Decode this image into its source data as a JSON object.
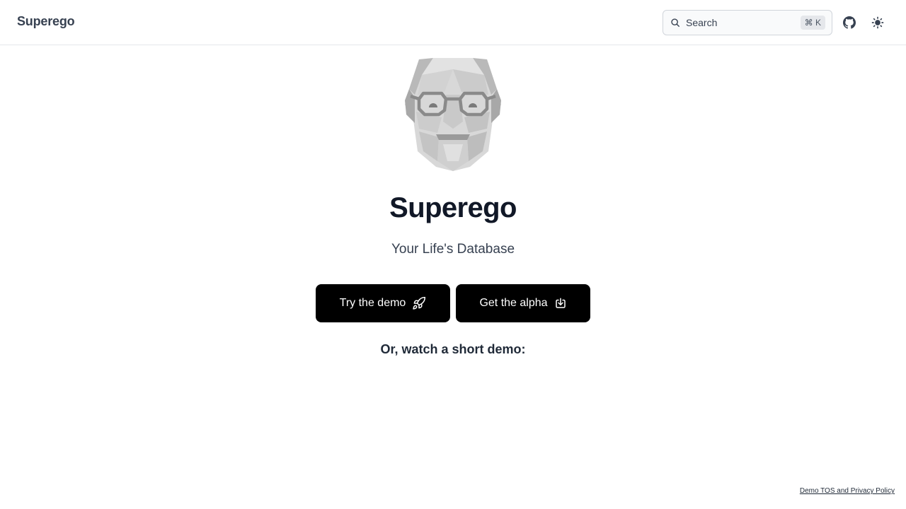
{
  "header": {
    "brand": "Superego",
    "search": {
      "label": "Search",
      "shortcut": "⌘ K",
      "icon": "search-icon"
    },
    "github_icon": "github-icon",
    "theme_icon": "sun-icon"
  },
  "hero": {
    "title": "Superego",
    "subtitle": "Your Life's Database",
    "avatar_icon": "bearded-face-with-glasses-icon",
    "buttons": [
      {
        "label": "Try the demo",
        "icon": "rocket-icon"
      },
      {
        "label": "Get the alpha",
        "icon": "download-icon"
      }
    ],
    "watch_heading": "Or, watch a short demo:"
  },
  "footer": {
    "link": "Demo TOS and Privacy Policy"
  },
  "colors": {
    "button_bg": "#000000",
    "button_text": "#ffffff",
    "border": "#e5e7eb"
  }
}
